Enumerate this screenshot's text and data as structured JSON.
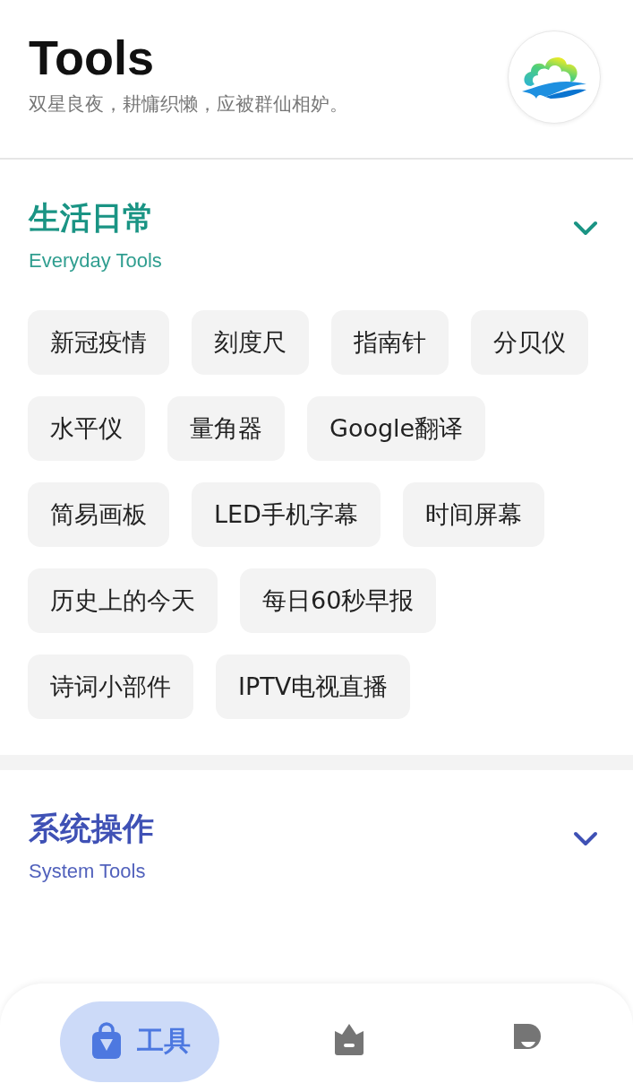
{
  "header": {
    "title": "Tools",
    "subtitle": "双星良夜，耕慵织懒，应被群仙相妒。"
  },
  "sections": [
    {
      "title": "生活日常",
      "subtitle": "Everyday Tools",
      "color": "#1a9484",
      "tools": [
        "新冠疫情",
        "刻度尺",
        "指南针",
        "分贝仪",
        "水平仪",
        "量角器",
        "Google翻译",
        "简易画板",
        "LED手机字幕",
        "时间屏幕",
        "历史上的今天",
        "每日60秒早报",
        "诗词小部件",
        "IPTV电视直播"
      ]
    },
    {
      "title": "系统操作",
      "subtitle": "System Tools",
      "color": "#3f51b5"
    }
  ],
  "nav": [
    {
      "kind": "bag",
      "label": "工具",
      "selected": true
    },
    {
      "kind": "crown",
      "selected": false
    },
    {
      "kind": "person",
      "selected": false
    }
  ]
}
